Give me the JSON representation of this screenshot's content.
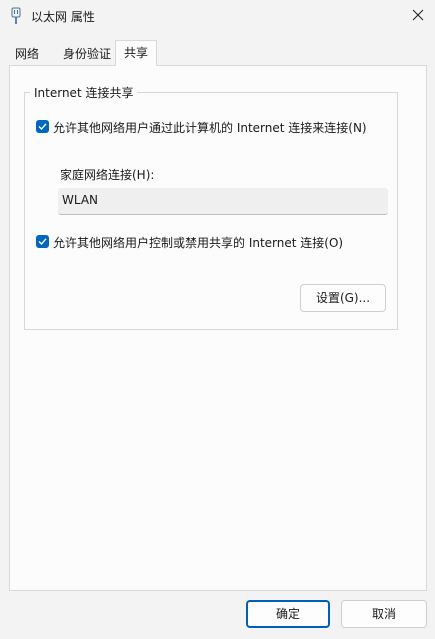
{
  "window": {
    "title": "以太网 属性"
  },
  "tabs": [
    {
      "label": "网络"
    },
    {
      "label": "身份验证"
    },
    {
      "label": "共享"
    }
  ],
  "sharing": {
    "group_title": "Internet 连接共享",
    "allow_share": {
      "label": "允许其他网络用户通过此计算机的 Internet 连接来连接(N)",
      "checked": true
    },
    "home_network_label": "家庭网络连接(H):",
    "home_network_value": "WLAN",
    "allow_control": {
      "label": "允许其他网络用户控制或禁用共享的 Internet 连接(O)",
      "checked": true
    },
    "settings_button": "设置(G)..."
  },
  "footer": {
    "ok": "确定",
    "cancel": "取消"
  },
  "colors": {
    "accent": "#0067c0",
    "background": "#f3f3f3"
  }
}
